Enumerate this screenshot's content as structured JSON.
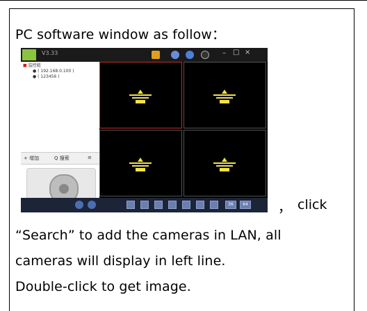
{
  "doc": {
    "line1": "PC software window as follow：",
    "comma": "，",
    "click": "click",
    "line3": "“Search” to add the cameras in LAN, all",
    "line4": "cameras will display in left line.",
    "line5": "Double-click to get image."
  },
  "app": {
    "version": "V3.33",
    "tree": {
      "root": "监控组",
      "items": [
        "( 192.168.0.100 )",
        "( 123456 )"
      ]
    },
    "toolbar": {
      "add": "+ 增加",
      "search": "Q 搜索",
      "list": "≡"
    },
    "bottom_buttons": [
      "36",
      "64"
    ]
  },
  "colors": {
    "selected_border": "#c0302c",
    "logo_yellow": "#f2e24a",
    "bottom_bar": "#1c2438"
  }
}
